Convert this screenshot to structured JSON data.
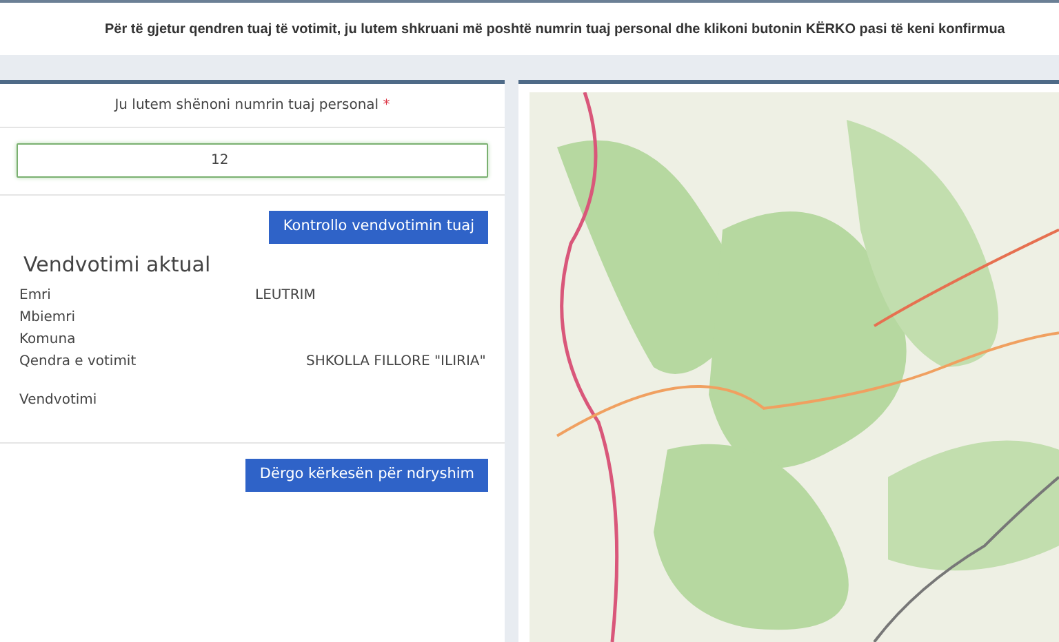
{
  "header": {
    "text": "Për të gjetur qendren tuaj të votimit, ju lutem shkruani më poshtë numrin tuaj personal dhe klikoni butonin KËRKO pasi të keni konfirmua"
  },
  "form": {
    "label": "Ju lutem shënoni numrin tuaj personal",
    "required_mark": "*",
    "personal_number": {
      "value": "12"
    },
    "check_button": "Kontrollo vendvotimin tuaj"
  },
  "current": {
    "title": "Vendvotimi aktual",
    "fields": [
      {
        "label": "Emri",
        "value": "LEUTRIM"
      },
      {
        "label": "Mbiemri"
      },
      {
        "label": "Komuna"
      },
      {
        "label": "Qendra e votimit",
        "value": "SHKOLLA FILLORE \"ILIRIA\""
      },
      {
        "label": "Vendvotimi"
      }
    ],
    "change_button": "Dërgo kërkesën për ndryshim"
  }
}
